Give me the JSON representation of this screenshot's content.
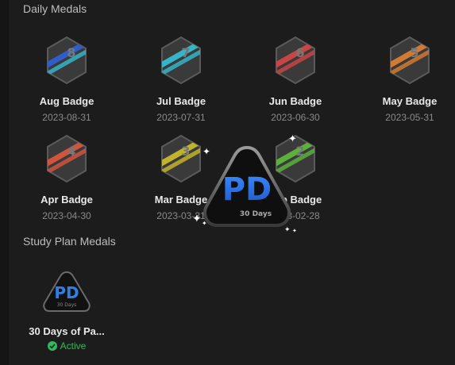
{
  "sections": {
    "daily_title": "Daily Medals",
    "study_title": "Study Plan Medals"
  },
  "daily_badges": [
    {
      "name": "Aug Badge",
      "date": "2023-08-31",
      "number": "8",
      "color": "#2f5ec9"
    },
    {
      "name": "Jul Badge",
      "date": "2023-07-31",
      "number": "7",
      "color": "#35b5c9"
    },
    {
      "name": "Jun Badge",
      "date": "2023-06-30",
      "number": "6",
      "color": "#c94545"
    },
    {
      "name": "May Badge",
      "date": "2023-05-31",
      "number": "5",
      "color": "#d07a35"
    },
    {
      "name": "Apr Badge",
      "date": "2023-04-30",
      "number": "4",
      "color": "#d0553f"
    },
    {
      "name": "Mar Badge",
      "date": "2023-03-31",
      "number": "3",
      "color": "#c2b42a"
    },
    {
      "name": "Feb Badge",
      "date": "2023-02-28",
      "number": "2",
      "color": "#5cb03c"
    }
  ],
  "study_badge": {
    "name": "30 Days of Pa...",
    "status": "Active",
    "logo_text": "PD",
    "logo_sub": "30 Days"
  },
  "popup_badge": {
    "logo_text": "PD",
    "logo_sub": "30 Days"
  },
  "colors": {
    "active_green": "#2cbb5d",
    "pd_blue": "#2f7fe8"
  }
}
